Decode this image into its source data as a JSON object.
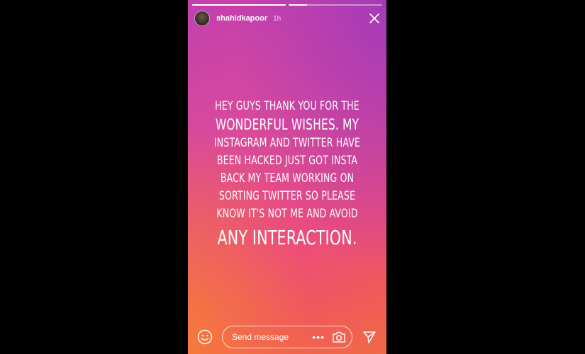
{
  "story": {
    "progress": [
      1.0,
      0.2
    ],
    "username": "shahidkapoor",
    "time": "1h",
    "message_lines": [
      "HEY GUYS THANK YOU FOR THE",
      "WONDERFUL WISHES. MY",
      "INSTAGRAM AND TWITTER HAVE",
      "BEEN HACKED JUST GOT INSTA",
      "BACK MY TEAM WORKING ON",
      "SORTING TWITTER SO PLEASE",
      "KNOW IT'S NOT ME AND AVOID",
      "ANY INTERACTION."
    ]
  },
  "footer": {
    "message_placeholder": "Send message"
  },
  "icons": {
    "close": "close-icon",
    "emoji": "emoji-icon",
    "more": "more-dots-icon",
    "camera": "camera-icon",
    "send": "send-icon"
  },
  "colors": {
    "gradient_top": "#c23fb0",
    "gradient_mid": "#ec4c7c",
    "gradient_bottom_left": "#f57a3a"
  }
}
